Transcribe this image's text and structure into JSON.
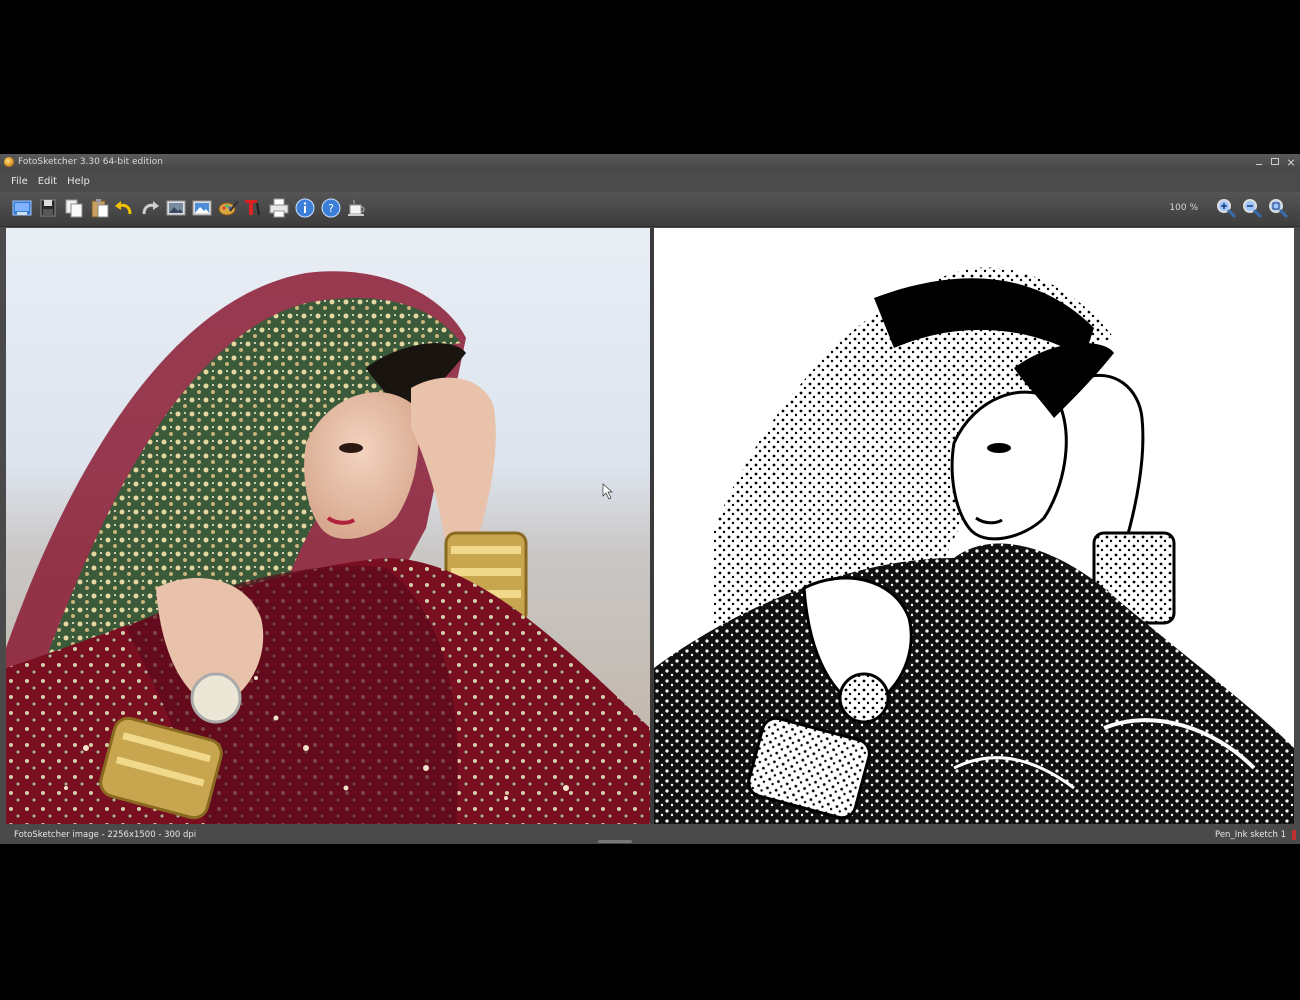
{
  "window": {
    "title": "FotoSketcher 3.30 64-bit edition"
  },
  "menu": {
    "items": [
      "File",
      "Edit",
      "Help"
    ]
  },
  "toolbar": {
    "tools": [
      {
        "name": "open-image-icon"
      },
      {
        "name": "save-icon"
      },
      {
        "name": "copy-icon"
      },
      {
        "name": "paste-icon"
      },
      {
        "name": "undo-icon"
      },
      {
        "name": "redo-icon"
      },
      {
        "name": "show-original-icon"
      },
      {
        "name": "show-result-icon"
      },
      {
        "name": "drawing-parameters-icon"
      },
      {
        "name": "add-text-icon"
      },
      {
        "name": "print-icon"
      },
      {
        "name": "info-icon"
      },
      {
        "name": "help-icon"
      },
      {
        "name": "donate-coffee-icon"
      }
    ],
    "zoom": "100 %",
    "zoom_tools": [
      {
        "name": "zoom-in-icon"
      },
      {
        "name": "zoom-out-icon"
      },
      {
        "name": "zoom-fit-icon"
      }
    ]
  },
  "status": {
    "left": "FotoSketcher image - 2256x1500 - 300 dpi",
    "right": "Pen_Ink sketch 1"
  },
  "colors": {
    "accent_red": "#c03030",
    "app_background": "#4a4a4a"
  }
}
